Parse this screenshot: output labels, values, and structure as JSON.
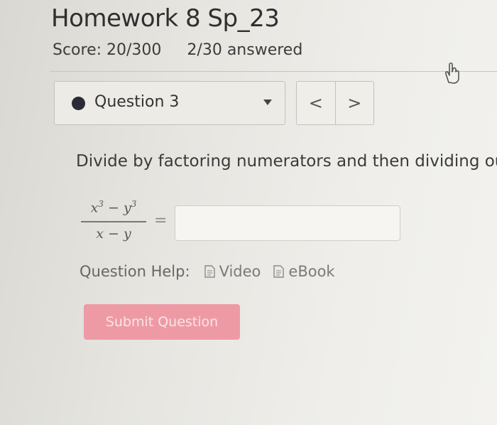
{
  "header": {
    "title": "Homework 8 Sp_23",
    "score": "Score: 20/300",
    "answered": "2/30 answered"
  },
  "question_nav": {
    "selected_label": "Question 3",
    "prev_symbol": "<",
    "next_symbol": ">"
  },
  "question": {
    "prompt": "Divide by factoring numerators and then dividing out",
    "numerator": {
      "a": "x",
      "a_exp": "3",
      "op": "−",
      "b": "y",
      "b_exp": "3"
    },
    "denominator": {
      "a": "x",
      "op": "−",
      "b": "y"
    },
    "equals": "=",
    "answer_value": ""
  },
  "help": {
    "label": "Question Help:",
    "video": "Video",
    "ebook": "eBook"
  },
  "actions": {
    "submit_label": "Submit Question"
  },
  "colors": {
    "submit_bg": "#ee9aa5",
    "dot": "#2b2b37"
  }
}
